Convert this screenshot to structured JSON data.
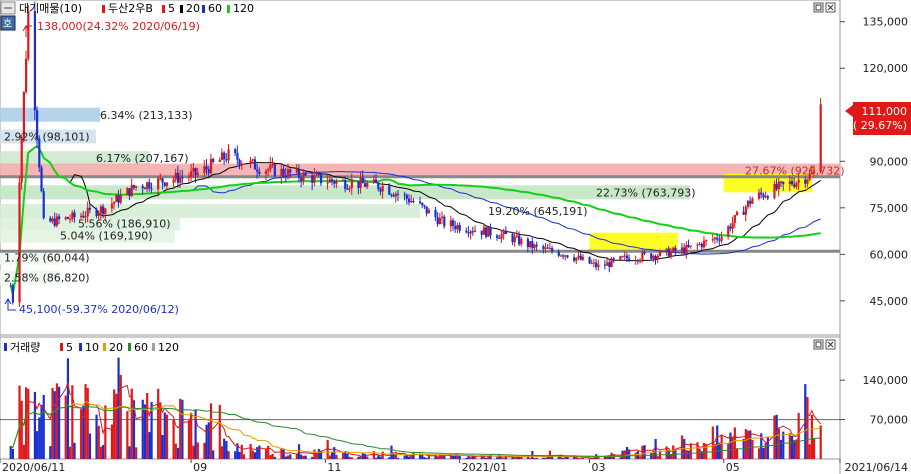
{
  "legend_price": {
    "items": [
      {
        "label": "대기매물(10)",
        "color": "#9aa6a6"
      },
      {
        "label": "두산2우B",
        "color": "#e01818"
      },
      {
        "label": "5",
        "color": "#e01818"
      },
      {
        "label": "20",
        "color": "#000000"
      },
      {
        "label": "60",
        "color": "#1a2fd0"
      },
      {
        "label": "120",
        "color": "#14d014"
      }
    ]
  },
  "legend_volume": {
    "items": [
      {
        "label": "거래량",
        "color": "#1a2fd0"
      },
      {
        "label": "5",
        "color": "#e01818"
      },
      {
        "label": "10",
        "color": "#1a2fd0"
      },
      {
        "label": "20",
        "color": "#e0a000"
      },
      {
        "label": "60",
        "color": "#2a8a2a"
      },
      {
        "label": "120",
        "color": "#a0a0a0"
      }
    ]
  },
  "annotations": {
    "high": "138,000(24.32% 2020/06/19)",
    "low": "45,100(-59.37% 2020/06/12)",
    "current_price": "111,000",
    "current_change": "( 29.67%)"
  },
  "supply_zones": [
    {
      "label": "6.34% (213,133)",
      "price": 105000,
      "color": "#a8cce8"
    },
    {
      "label": "2.92% (98,101)",
      "price": 98000,
      "color": "#cde1ee"
    },
    {
      "label": "6.17% (207,167)",
      "price": 91000,
      "color": "#cde6cd"
    },
    {
      "label": "27.67% (929,732)",
      "price": 87000,
      "color": "#f3a8a8"
    },
    {
      "label": "22.73% (763,793)",
      "price": 80000,
      "color": "#bfe3bf"
    },
    {
      "label": "19.20% (645,191)",
      "price": 74000,
      "color": "#d3ecd3"
    },
    {
      "label": "5.56% (186,910)",
      "price": 70000,
      "color": "#d9efd9"
    },
    {
      "label": "5.04% (169,190)",
      "price": 66000,
      "color": "#e1f2e1"
    },
    {
      "label": "1.79% (60,044)",
      "price": 59000,
      "color": "#eef6ee"
    },
    {
      "label": "2.58% (86,820)",
      "price": 52500,
      "color": "#eef6ee"
    }
  ],
  "chart_data": {
    "type": "candlestick",
    "title": "두산2우B",
    "x_labels": [
      "2020/06/11",
      "09",
      "11",
      "2021/01",
      "03",
      "05",
      "2021/06/14"
    ],
    "price_axis": {
      "ticks": [
        45000,
        60000,
        75000,
        90000,
        120000,
        135000
      ],
      "range": [
        34000,
        142000
      ]
    },
    "volume_axis": {
      "ticks": [
        70000,
        140000
      ],
      "range": [
        0,
        190000
      ]
    },
    "horizontal_lines": [
      61000,
      85000
    ],
    "volume_reference": 70000,
    "support_zones": [
      {
        "from": "2021/03",
        "to": "2021/04",
        "low": 61000,
        "high": 67000,
        "color": "#ffff00"
      },
      {
        "from": "2021/05",
        "to": "2021/06",
        "low": 80000,
        "high": 86000,
        "color": "#ffff00"
      }
    ],
    "price_points": [
      [
        "2020/06/11",
        50000
      ],
      [
        "2020/06/12",
        45100
      ],
      [
        "2020/06/19",
        138000
      ],
      [
        "2020/06/26",
        70000
      ],
      [
        "2020/07/10",
        72000
      ],
      [
        "2020/07/24",
        75000
      ],
      [
        "2020/08/07",
        82000
      ],
      [
        "2020/08/21",
        84000
      ],
      [
        "2020/09/04",
        86000
      ],
      [
        "2020/09/18",
        92000
      ],
      [
        "2020/10/02",
        88000
      ],
      [
        "2020/10/16",
        86000
      ],
      [
        "2020/10/30",
        84000
      ],
      [
        "2020/11/13",
        83000
      ],
      [
        "2020/11/27",
        82000
      ],
      [
        "2020/12/11",
        77000
      ],
      [
        "2020/12/25",
        70000
      ],
      [
        "2021/01/08",
        68000
      ],
      [
        "2021/01/22",
        66000
      ],
      [
        "2021/02/05",
        62000
      ],
      [
        "2021/02/19",
        60000
      ],
      [
        "2021/03/05",
        56000
      ],
      [
        "2021/03/19",
        59000
      ],
      [
        "2021/04/02",
        60000
      ],
      [
        "2021/04/16",
        62000
      ],
      [
        "2021/04/30",
        66000
      ],
      [
        "2021/05/14",
        78000
      ],
      [
        "2021/05/28",
        82000
      ],
      [
        "2021/06/11",
        86000
      ],
      [
        "2021/06/14",
        111000
      ]
    ],
    "volume_points": [
      [
        "2020/06/11",
        60000
      ],
      [
        "2020/06/19",
        140000
      ],
      [
        "2020/07/17",
        130000
      ],
      [
        "2020/09/01",
        120000
      ],
      [
        "2020/09/15",
        40000
      ],
      [
        "2020/10/15",
        20000
      ],
      [
        "2021/01/01",
        8000
      ],
      [
        "2021/03/01",
        6000
      ],
      [
        "2021/05/01",
        60000
      ],
      [
        "2021/06/14",
        95000
      ]
    ]
  }
}
